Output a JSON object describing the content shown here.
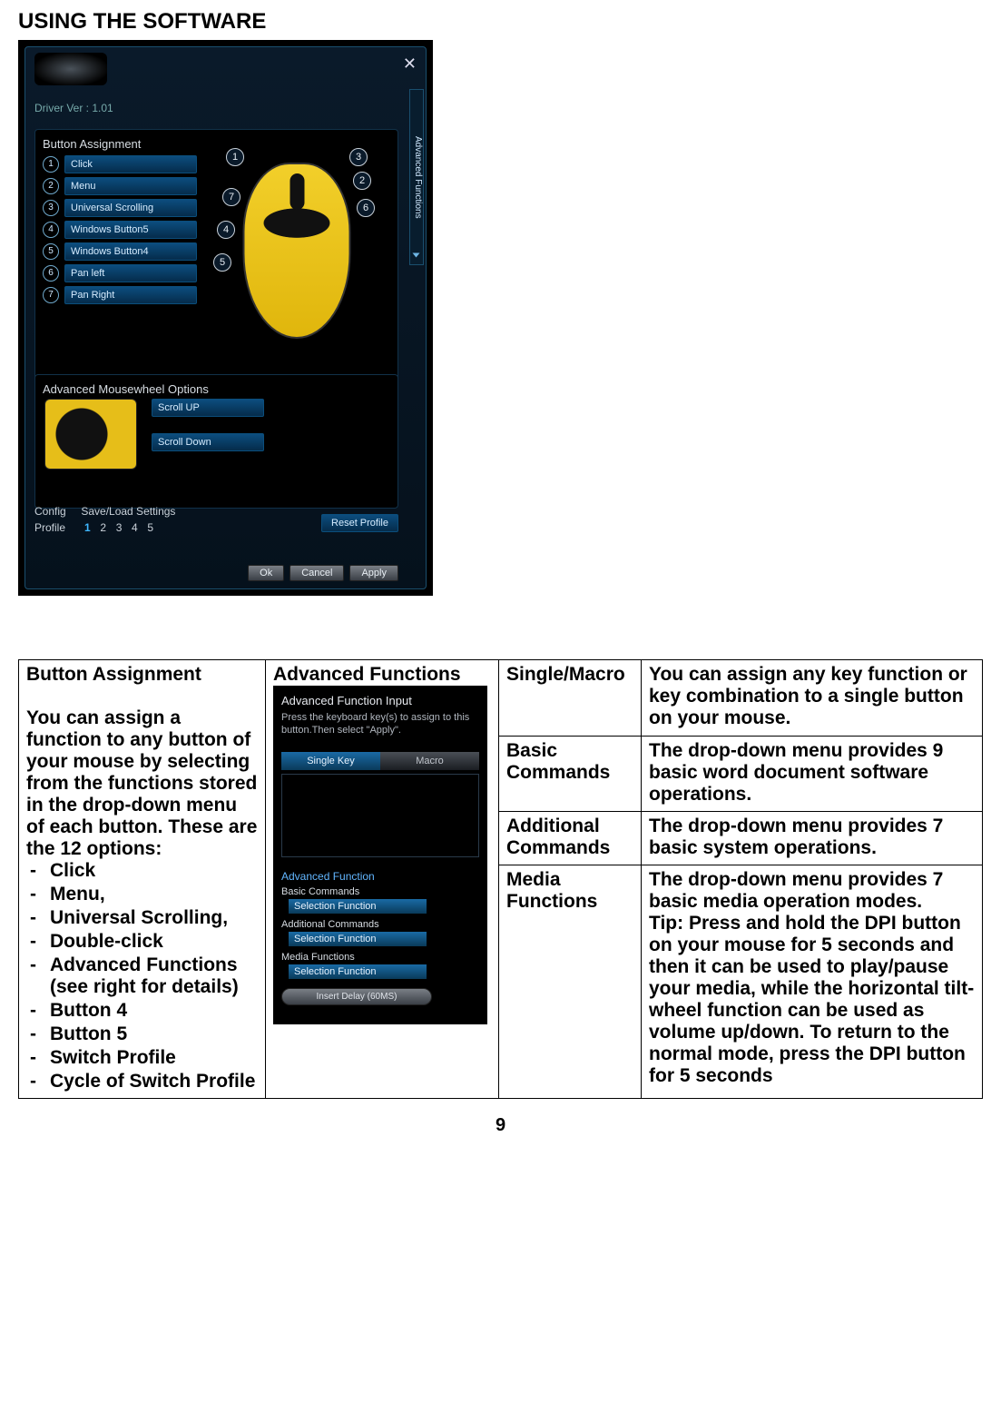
{
  "page": {
    "title": "USING THE SOFTWARE",
    "number": "9"
  },
  "app": {
    "driver_label": "Driver Ver :",
    "driver_ver": "1.01",
    "side_tab": "Advanced Functions",
    "assign_title": "Button Assignment",
    "assign": [
      {
        "n": "1",
        "label": "Click"
      },
      {
        "n": "2",
        "label": "Menu"
      },
      {
        "n": "3",
        "label": "Universal Scrolling"
      },
      {
        "n": "4",
        "label": "Windows Button5"
      },
      {
        "n": "5",
        "label": "Windows Button4"
      },
      {
        "n": "6",
        "label": "Pan left"
      },
      {
        "n": "7",
        "label": "Pan Right"
      }
    ],
    "callouts": [
      "1",
      "2",
      "3",
      "4",
      "5",
      "6",
      "7"
    ],
    "wheel_title": "Advanced Mousewheel Options",
    "wheel_up": "Scroll UP",
    "wheel_down": "Scroll Down",
    "config_label": "Config",
    "saveload_label": "Save/Load Settings",
    "profile_label": "Profile",
    "profiles": [
      "1",
      "2",
      "3",
      "4",
      "5"
    ],
    "active_profile": "1",
    "reset_label": "Reset Profile",
    "ok": "Ok",
    "cancel": "Cancel",
    "apply": "Apply"
  },
  "adv": {
    "title": "Advanced Function Input",
    "desc": "Press the keyboard key(s) to assign to this button.Then select \"Apply\".",
    "tab_single": "Single Key",
    "tab_macro": "Macro",
    "section": "Advanced Function",
    "basic": "Basic Commands",
    "addl": "Additional Commands",
    "media": "Media Functions",
    "selfn": "Selection Function",
    "insert": "Insert Delay (60MS)"
  },
  "table": {
    "col1": {
      "heading": "Button Assignment",
      "body": "You can assign a function to any button of your mouse by selecting from the functions stored in the drop-down menu of each button. These are the 12 options:",
      "opts": [
        "Click",
        "Menu,",
        "Universal Scrolling,",
        "Double-click",
        "Advanced Functions (see right for details)",
        "Button 4",
        "Button 5",
        "Switch Profile",
        "Cycle of Switch Profile"
      ]
    },
    "col2": {
      "heading": "Advanced Functions"
    },
    "rows": [
      {
        "k": "Single/Macro",
        "v": "You can assign any key function or key combination to a single button on your mouse."
      },
      {
        "k": "Basic Commands",
        "v": "The drop-down menu provides 9 basic word document software operations."
      },
      {
        "k": "Additional Commands",
        "v": "The drop-down menu provides 7 basic system operations."
      },
      {
        "k": "Media Functions",
        "v": "The drop-down menu provides 7 basic media operation modes.\nTip: Press and hold the DPI button on your mouse for 5 seconds and then it can be used to play/pause your media, while the horizontal tilt-wheel function can be used as volume up/down. To return to the normal mode, press the DPI button for 5 seconds"
      }
    ]
  }
}
